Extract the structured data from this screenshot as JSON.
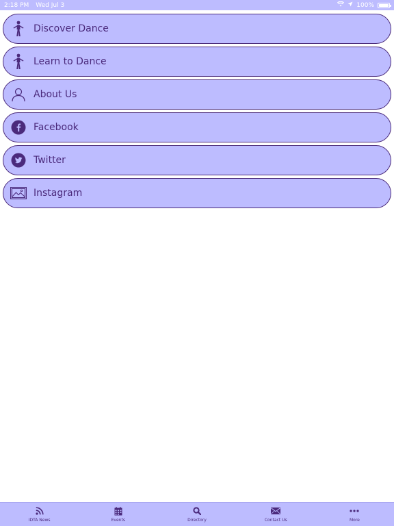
{
  "status_bar": {
    "time": "2:18 PM",
    "date": "Wed Jul 3",
    "battery": "100%"
  },
  "menu": {
    "items": [
      {
        "label": "Discover Dance",
        "icon": "person-walking-icon"
      },
      {
        "label": "Learn to Dance",
        "icon": "person-walking-icon"
      },
      {
        "label": "About Us",
        "icon": "person-outline-icon"
      },
      {
        "label": "Facebook",
        "icon": "facebook-icon"
      },
      {
        "label": "Twitter",
        "icon": "twitter-icon"
      },
      {
        "label": "Instagram",
        "icon": "image-icon"
      }
    ]
  },
  "tab_bar": {
    "tabs": [
      {
        "label": "IDTA News",
        "icon": "rss-icon"
      },
      {
        "label": "Events",
        "icon": "calendar-icon"
      },
      {
        "label": "Directory",
        "icon": "search-icon"
      },
      {
        "label": "Contact Us",
        "icon": "mail-icon"
      },
      {
        "label": "More",
        "icon": "more-icon"
      }
    ]
  },
  "colors": {
    "accent": "#bdbcff",
    "text": "#4b2a7c",
    "border": "#4a2a7a"
  }
}
